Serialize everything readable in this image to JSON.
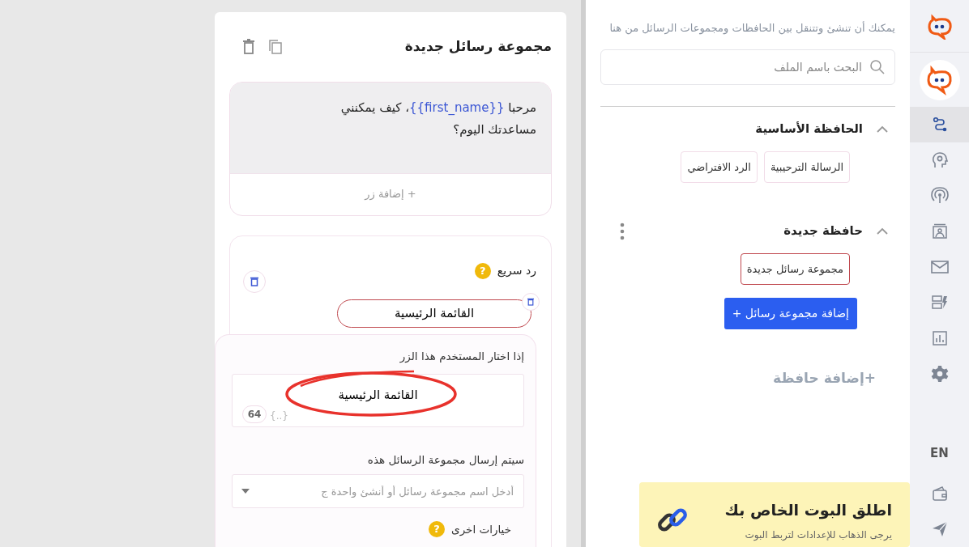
{
  "sidebar": {
    "items": [
      {
        "kind": "logo",
        "selected": false
      },
      {
        "kind": "bot",
        "selected": false
      },
      {
        "kind": "flow",
        "selected": true
      },
      {
        "kind": "brain",
        "selected": false
      },
      {
        "kind": "broadcast",
        "selected": false
      },
      {
        "kind": "contact",
        "selected": false
      },
      {
        "kind": "mail",
        "selected": false
      },
      {
        "kind": "widgets",
        "selected": false
      },
      {
        "kind": "chart",
        "selected": false
      },
      {
        "kind": "settings",
        "selected": false
      }
    ],
    "language": "EN",
    "bottom_items": [
      {
        "kind": "wallet"
      },
      {
        "kind": "send"
      }
    ]
  },
  "folders_panel": {
    "intro": "يمكنك أن تنشئ وتتنقل بين الحافظات ومجموعات الرسائل من هنا",
    "search": {
      "placeholder": "البحث باسم الملف"
    },
    "folders": [
      {
        "title": "الحافظة الأساسية",
        "expanded": true,
        "menu": false,
        "groups": [
          {
            "label": "الرسالة الترحيبية",
            "selected": false
          },
          {
            "label": "الرد الافتراضي",
            "selected": false
          }
        ]
      },
      {
        "title": "حافظة جديدة",
        "expanded": true,
        "menu": true,
        "groups": [
          {
            "label": "مجموعة رسائل جديدة",
            "selected": true
          }
        ],
        "add_group": "إضافة مجموعة رسائل +"
      }
    ],
    "add_folder": "+إضافة حافظة",
    "banner": {
      "title": "اطلق البوت الخاص بك",
      "text": "يرجى الذهاب للإعدادات لتربط البوت"
    }
  },
  "editor": {
    "title": "مجموعة رسائل جديدة",
    "message": {
      "parts": [
        {
          "kind": "plain",
          "text": "مرحبا "
        },
        {
          "kind": "variable",
          "text": "{{first_name}}"
        },
        {
          "kind": "plain",
          "text": "، كيف يمكنني مساعدتك اليوم؟"
        }
      ],
      "add_button": "+ إضافة زر"
    },
    "quick_reply": {
      "title": "رد سريع",
      "buttons": [
        {
          "label": "القائمة الرئيسية"
        }
      ],
      "if_label": "إذا اختار المستخدم هذا الزر",
      "value": "القائمة الرئيسية",
      "counter": "64",
      "variables": "{..}",
      "help_mark": "?",
      "more_options_help": "?",
      "send_label": "سيتم إرسال مجموعة الرسائل هذه",
      "select_placeholder": "أدخل اسم مجموعة رسائل أو أنشئ واحدة ج",
      "more_options": "خيارات اخرى"
    }
  }
}
